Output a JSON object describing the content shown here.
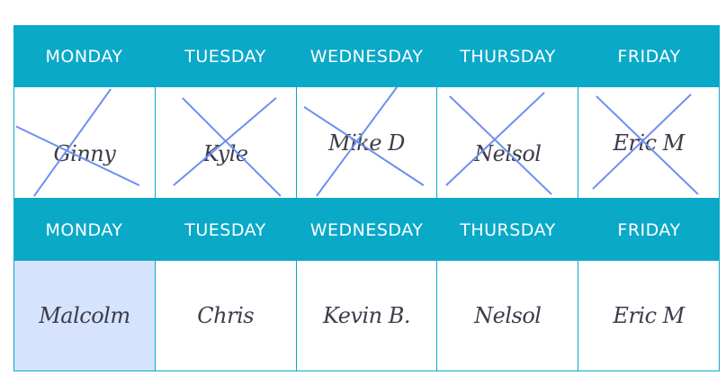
{
  "week1": {
    "days": [
      "MONDAY",
      "TUESDAY",
      "WEDNESDAY",
      "THURSDAY",
      "FRIDAY"
    ],
    "names": [
      "Ginny",
      "Kyle",
      "Mike D",
      "Nelsol",
      "Eric M"
    ]
  },
  "week2": {
    "days": [
      "MONDAY",
      "TUESDAY",
      "WEDNESDAY",
      "THURSDAY",
      "FRIDAY"
    ],
    "names": [
      "Malcolm",
      "Chris",
      "Kevin B.",
      "Nelsol",
      "Eric M"
    ]
  },
  "colors": {
    "header": "#0aa9c8",
    "cross": "#6f8df0",
    "highlight": "#d6e3fc"
  }
}
